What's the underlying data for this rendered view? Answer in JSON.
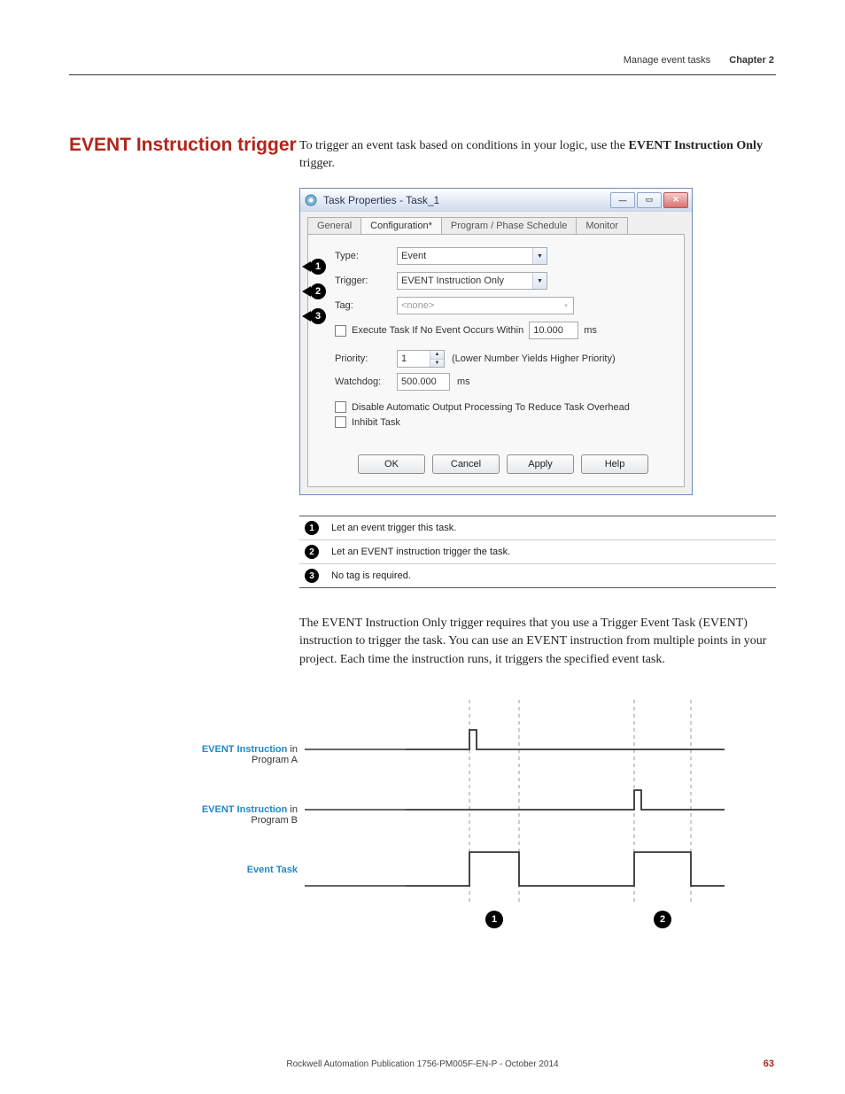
{
  "header": {
    "section": "Manage event tasks",
    "chapter": "Chapter 2"
  },
  "section_heading": "EVENT Instruction trigger",
  "intro_text_prefix": "To trigger an event task based on conditions in your logic, use the ",
  "intro_text_bold": "EVENT Instruction Only",
  "intro_text_suffix": " trigger.",
  "dialog": {
    "title": "Task Properties - Task_1",
    "tabs": [
      "General",
      "Configuration*",
      "Program / Phase Schedule",
      "Monitor"
    ],
    "active_tab_index": 1,
    "fields": {
      "type_label": "Type:",
      "type_value": "Event",
      "trigger_label": "Trigger:",
      "trigger_value": "EVENT Instruction Only",
      "tag_label": "Tag:",
      "tag_value": "<none>",
      "exec_checkbox_label": "Execute Task If No Event Occurs Within",
      "exec_value": "10.000",
      "exec_unit": "ms",
      "priority_label": "Priority:",
      "priority_value": "1",
      "priority_hint": "(Lower Number Yields Higher Priority)",
      "watchdog_label": "Watchdog:",
      "watchdog_value": "500.000",
      "watchdog_unit": "ms",
      "disable_checkbox_label": "Disable Automatic Output Processing To Reduce Task Overhead",
      "inhibit_checkbox_label": "Inhibit Task"
    },
    "buttons": {
      "ok": "OK",
      "cancel": "Cancel",
      "apply": "Apply",
      "help": "Help"
    }
  },
  "legend_rows": [
    "Let an event trigger this task.",
    "Let an EVENT instruction trigger the task.",
    "No tag is required."
  ],
  "paragraph2": "The EVENT Instruction Only trigger requires that you use a Trigger Event Task (EVENT) instruction to trigger the task. You can use an EVENT instruction from multiple points in your project. Each time the instruction runs, it triggers the specified event task.",
  "timing": {
    "label_a_prefix": "EVENT Instruction",
    "label_a_suffix": " in Program A",
    "label_b_prefix": "EVENT Instruction",
    "label_b_suffix": " in Program B",
    "label_task": "Event Task"
  },
  "footer": "Rockwell Automation Publication 1756-PM005F-EN-P - October 2014",
  "page_number": "63"
}
